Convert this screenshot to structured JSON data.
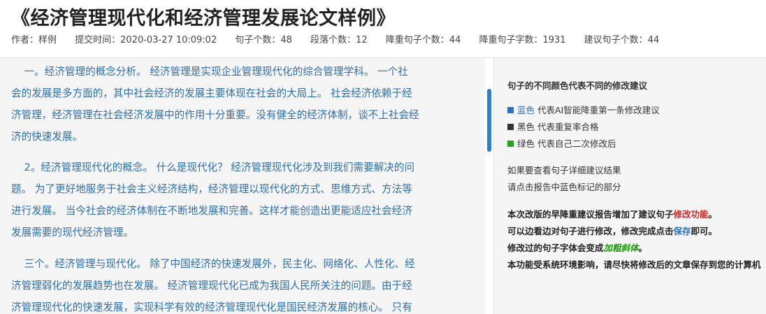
{
  "header": {
    "title": "《经济管理现代化和经济管理发展论文样例》",
    "meta": [
      "作者：样例",
      "提交时间：2020-03-27 10:09:02",
      "句子个数：48",
      "段落个数：12",
      "降重句子个数：44",
      "降重句子字数：1931",
      "建议句子个数：44"
    ]
  },
  "article": {
    "paragraphs": [
      [
        "    一。经济管理的概念分析。 经济管理是实现企业管理现代化的综合管理学科。 一个社",
        "会的发展是多方面的，其中社会经济的发展主要体现在社会的大局上。 社会经济依赖于经",
        "济管理，经济管理在社会经济发展中的作用十分重要。没有健全的经济体制，谈不上社会经",
        "济的快速发展。"
      ],
      [
        "    2。经济管理现代化的概念。 什么是现代化？ 经济管理现代化涉及到我们需要解决的问",
        "题。 为了更好地服务于社会主义经济结构，经济管理以现代化的方式、思维方式、方法等",
        "进行发展。 当今社会的经济体制在不断地发展和完善。这样才能创造出更能适应社会经济",
        "发展需要的现代经济管理。"
      ],
      [
        "    三个。经济管理与现代化。 除了中国经济的快速发展外，民主化、网络化、人性化、经",
        "济管理弱化的发展趋势也在发展。 经济管理现代化已成为我国人民所关注的问题。由于经",
        "济管理现代化的快速发展，实现科学有效的经济管理现代化是国民经济发展的核心。 只有"
      ]
    ]
  },
  "side": {
    "heading": "句子的不同颜色代表不同的修改建议",
    "legend": [
      {
        "name": "蓝色",
        "desc": " 代表AI智能降重第一条修改建议",
        "color": "#2d6fc5"
      },
      {
        "name": "黑色",
        "desc": " 代表重复率合格",
        "color": "#333333"
      },
      {
        "name": "绿色",
        "desc": " 代表自己二次修改后",
        "color": "#22a31a"
      }
    ],
    "hint_line1": "如果要查看句子详细建议结果",
    "hint_line2": "请点击报告中蓝色标记的部分",
    "note1_pre": "本次改版的早降重建议报告增加了建议句子",
    "note1_red": "修改功能",
    "note1_post": "。",
    "note2_pre": "可以边看边对句子进行修改，修改完成点击",
    "note2_link": "保存",
    "note2_post": "即可。",
    "note3_pre": "修改过的句子字体会变成",
    "note3_green": "加粗斜体",
    "note3_post": "。",
    "note4": "本功能受系统环境影响，请尽快将修改后的文章保存到您的计算机"
  }
}
